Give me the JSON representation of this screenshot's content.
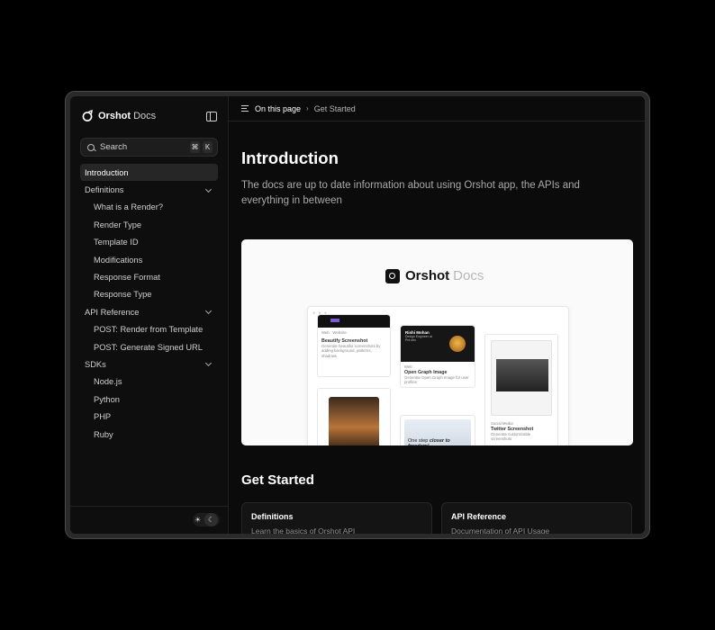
{
  "sidebar": {
    "brand": "Orshot",
    "brand_suffix": "Docs",
    "search_label": "Search",
    "shortcut": [
      "⌘",
      "K"
    ],
    "items": [
      {
        "label": "Introduction",
        "active": true,
        "sub": false
      },
      {
        "label": "Definitions",
        "group": true
      },
      {
        "label": "What is a Render?",
        "sub": true
      },
      {
        "label": "Render Type",
        "sub": true
      },
      {
        "label": "Template ID",
        "sub": true
      },
      {
        "label": "Modifications",
        "sub": true
      },
      {
        "label": "Response Format",
        "sub": true
      },
      {
        "label": "Response Type",
        "sub": true
      },
      {
        "label": "API Reference",
        "group": true
      },
      {
        "label": "POST: Render from Template",
        "sub": true
      },
      {
        "label": "POST: Generate Signed URL",
        "sub": true
      },
      {
        "label": "SDKs",
        "group": true
      },
      {
        "label": "Node.js",
        "sub": true
      },
      {
        "label": "Python",
        "sub": true
      },
      {
        "label": "PHP",
        "sub": true
      },
      {
        "label": "Ruby",
        "sub": true
      }
    ],
    "theme_icons": [
      "sun-icon",
      "moon-icon"
    ]
  },
  "topbar": {
    "on_this_page": "On this page",
    "current": "Get Started"
  },
  "main": {
    "title": "Introduction",
    "lead": "The docs are up to date information about using Orshot app, the APIs and everything in between",
    "hero": {
      "brand": "Orshot",
      "brand_suffix": "Docs",
      "cards": [
        {
          "tag1": "Web",
          "tag2": "Website",
          "title": "Beautify Screenshot",
          "desc": "Generate beautiful screenshots by adding background, patterns, shadows"
        },
        {
          "name": "Rishi Mohan",
          "sub": "Design Engineer at Pre.dev",
          "tag": "Web",
          "title": "Open Graph Image",
          "desc": "Generate Open Graph Image for user profiles"
        },
        {
          "tag": "Social Media",
          "title": "Twitter Screenshot",
          "desc": "Generate customizable screenshots"
        },
        {
          "quote_a": "One step ",
          "quote_b": "closer to freedom!"
        }
      ]
    },
    "get_started": "Get Started",
    "cards": [
      {
        "title": "Definitions",
        "desc": "Learn the basics of Orshot API"
      },
      {
        "title": "API Reference",
        "desc": "Documentation of API Usage"
      }
    ]
  }
}
